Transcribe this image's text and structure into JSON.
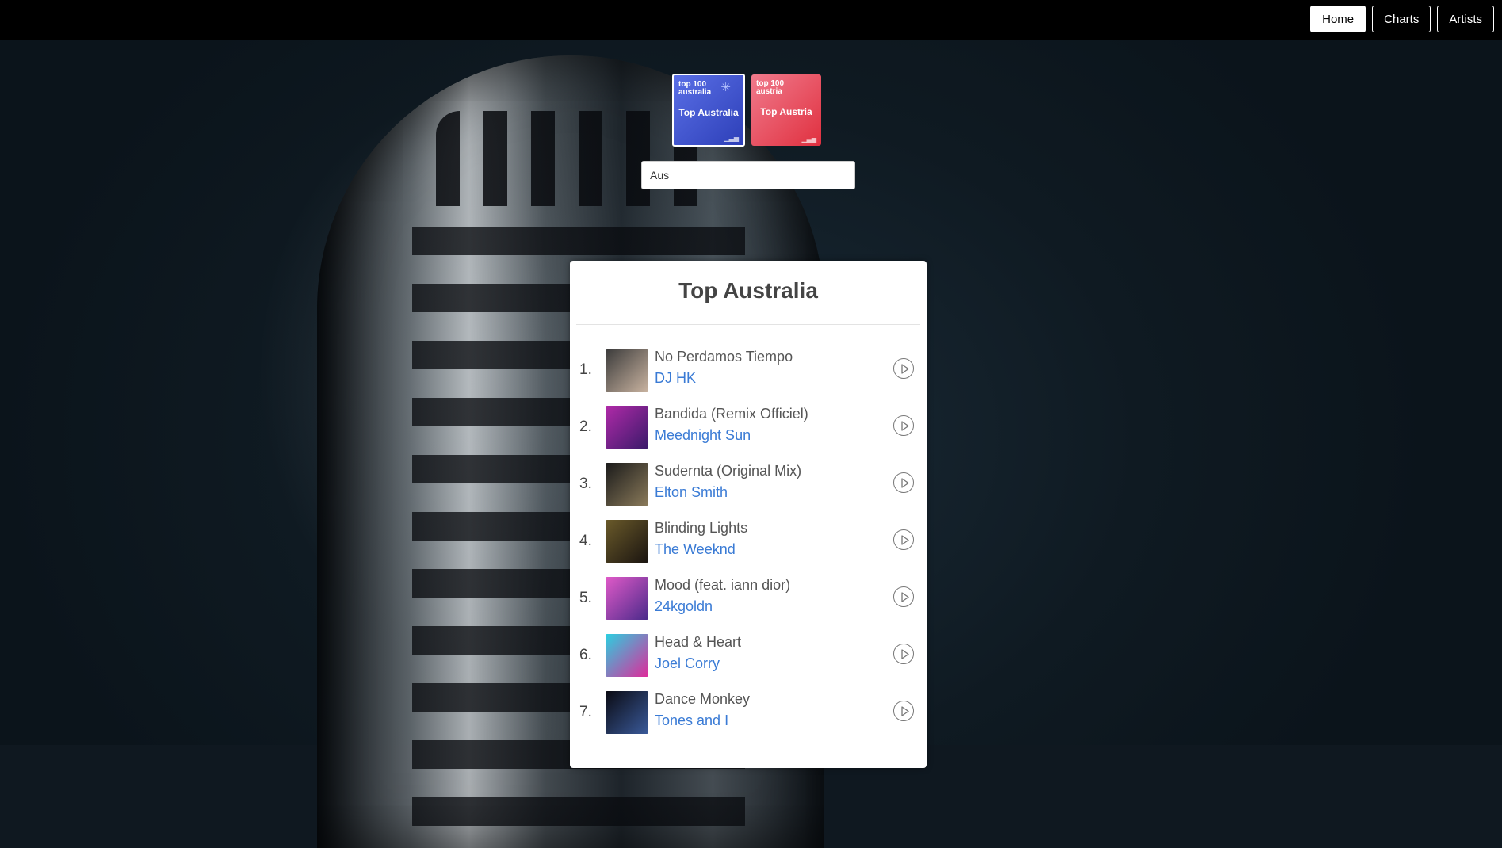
{
  "nav": {
    "items": [
      {
        "label": "Home",
        "active": true
      },
      {
        "label": "Charts",
        "active": false
      },
      {
        "label": "Artists",
        "active": false
      }
    ]
  },
  "tiles": [
    {
      "small_line1": "top 100",
      "small_line2": "australia",
      "big": "Top Australia",
      "color": "#3b4fd0",
      "selected": true,
      "icon": "star-icon"
    },
    {
      "small_line1": "top 100",
      "small_line2": "austria",
      "big": "Top Austria",
      "color": "#e63a4c",
      "selected": false
    }
  ],
  "search": {
    "value": "Aus",
    "placeholder": ""
  },
  "card": {
    "title": "Top Australia",
    "tracks": [
      {
        "rank": "1.",
        "title": "No Perdamos Tiempo",
        "artist": "DJ HK",
        "cover": [
          "#3a3a3a",
          "#c9b3a0"
        ]
      },
      {
        "rank": "2.",
        "title": "Bandida (Remix Officiel)",
        "artist": "Meednight Sun",
        "cover": [
          "#b02aa8",
          "#3a1a6a"
        ]
      },
      {
        "rank": "3.",
        "title": "Sudernta (Original Mix)",
        "artist": "Elton Smith",
        "cover": [
          "#1a1a1a",
          "#8a7a5a"
        ]
      },
      {
        "rank": "4.",
        "title": "Blinding Lights",
        "artist": "The Weeknd",
        "cover": [
          "#6a5a2a",
          "#1a1410"
        ]
      },
      {
        "rank": "5.",
        "title": "Mood (feat. iann dior)",
        "artist": "24kgoldn",
        "cover": [
          "#e05ac8",
          "#4a2a8a"
        ]
      },
      {
        "rank": "6.",
        "title": "Head & Heart",
        "artist": "Joel Corry",
        "cover": [
          "#2ad0e0",
          "#e02a9a"
        ]
      },
      {
        "rank": "7.",
        "title": "Dance Monkey",
        "artist": "Tones and I",
        "cover": [
          "#0a0a12",
          "#3a5a9a"
        ]
      }
    ]
  }
}
